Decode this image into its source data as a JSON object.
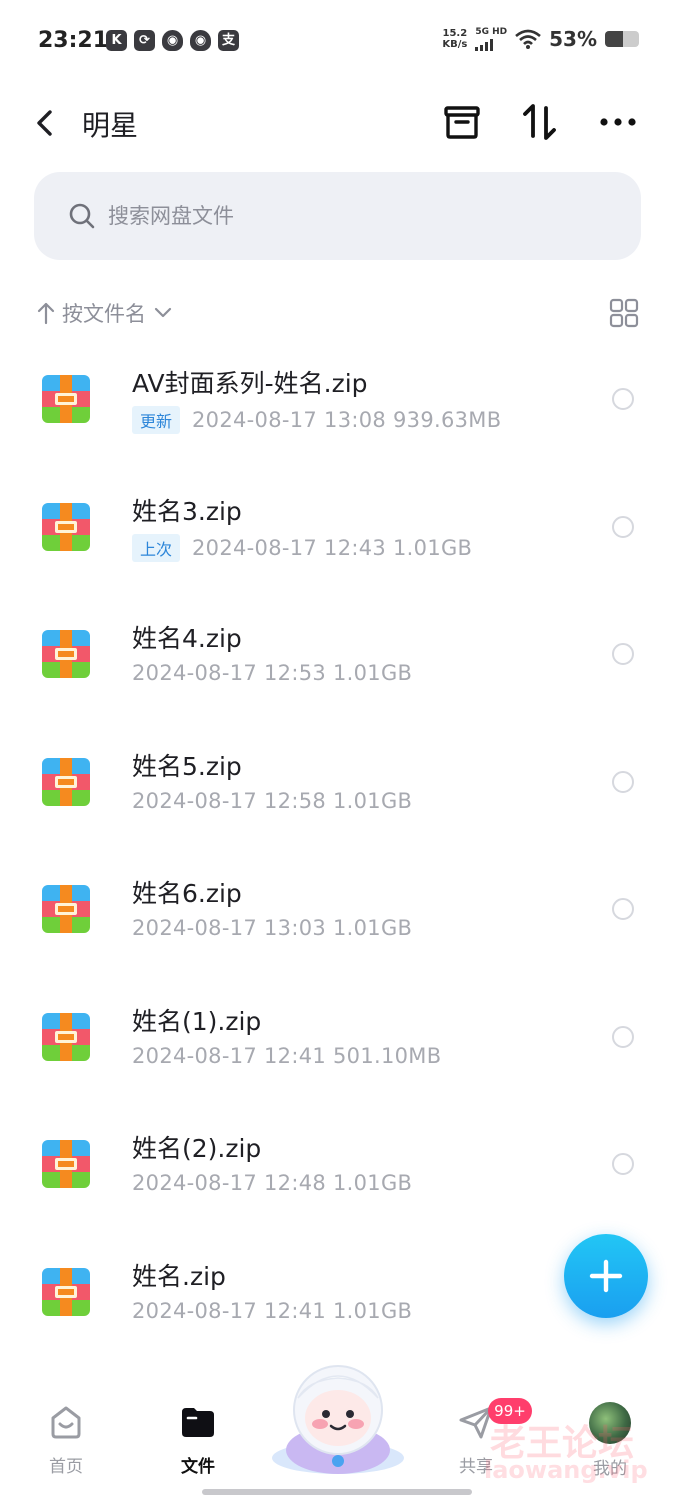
{
  "status_bar": {
    "time": "23:21",
    "app_icons": [
      "K",
      "sync-icon",
      "qq-icon",
      "qq-icon",
      "支"
    ],
    "speed": "15.2",
    "speed_unit": "KB/s",
    "network": "5G HD",
    "battery": "53%",
    "battery_level": 0.53
  },
  "header": {
    "title": "明星",
    "icons": [
      "back-icon",
      "archive-icon",
      "sort-icon",
      "more-icon"
    ]
  },
  "search": {
    "placeholder": "搜索网盘文件"
  },
  "sort": {
    "label": "按文件名"
  },
  "files": [
    {
      "name": "AV封面系列-姓名.zip",
      "tag": "更新",
      "meta": "2024-08-17  13:08  939.63MB"
    },
    {
      "name": "姓名3.zip",
      "tag": "上次",
      "meta": "2024-08-17  12:43  1.01GB"
    },
    {
      "name": "姓名4.zip",
      "tag": "",
      "meta": "2024-08-17  12:53  1.01GB"
    },
    {
      "name": "姓名5.zip",
      "tag": "",
      "meta": "2024-08-17  12:58  1.01GB"
    },
    {
      "name": "姓名6.zip",
      "tag": "",
      "meta": "2024-08-17  13:03  1.01GB"
    },
    {
      "name": "姓名(1).zip",
      "tag": "",
      "meta": "2024-08-17  12:41  501.10MB"
    },
    {
      "name": "姓名(2).zip",
      "tag": "",
      "meta": "2024-08-17  12:48  1.01GB"
    },
    {
      "name": "姓名.zip",
      "tag": "",
      "meta": "2024-08-17  12:41  1.01GB"
    }
  ],
  "bottom_nav": {
    "home": "首页",
    "files": "文件",
    "share": "共享",
    "me": "我的",
    "share_badge": "99+"
  },
  "watermark": {
    "line1": "老王论坛",
    "line2": "laowang.vip"
  },
  "colors": {
    "accent": "#1a9ff0",
    "badge": "#ff3e6c",
    "tag_bg": "#e6f3fc",
    "tag_text": "#2d86d9"
  }
}
